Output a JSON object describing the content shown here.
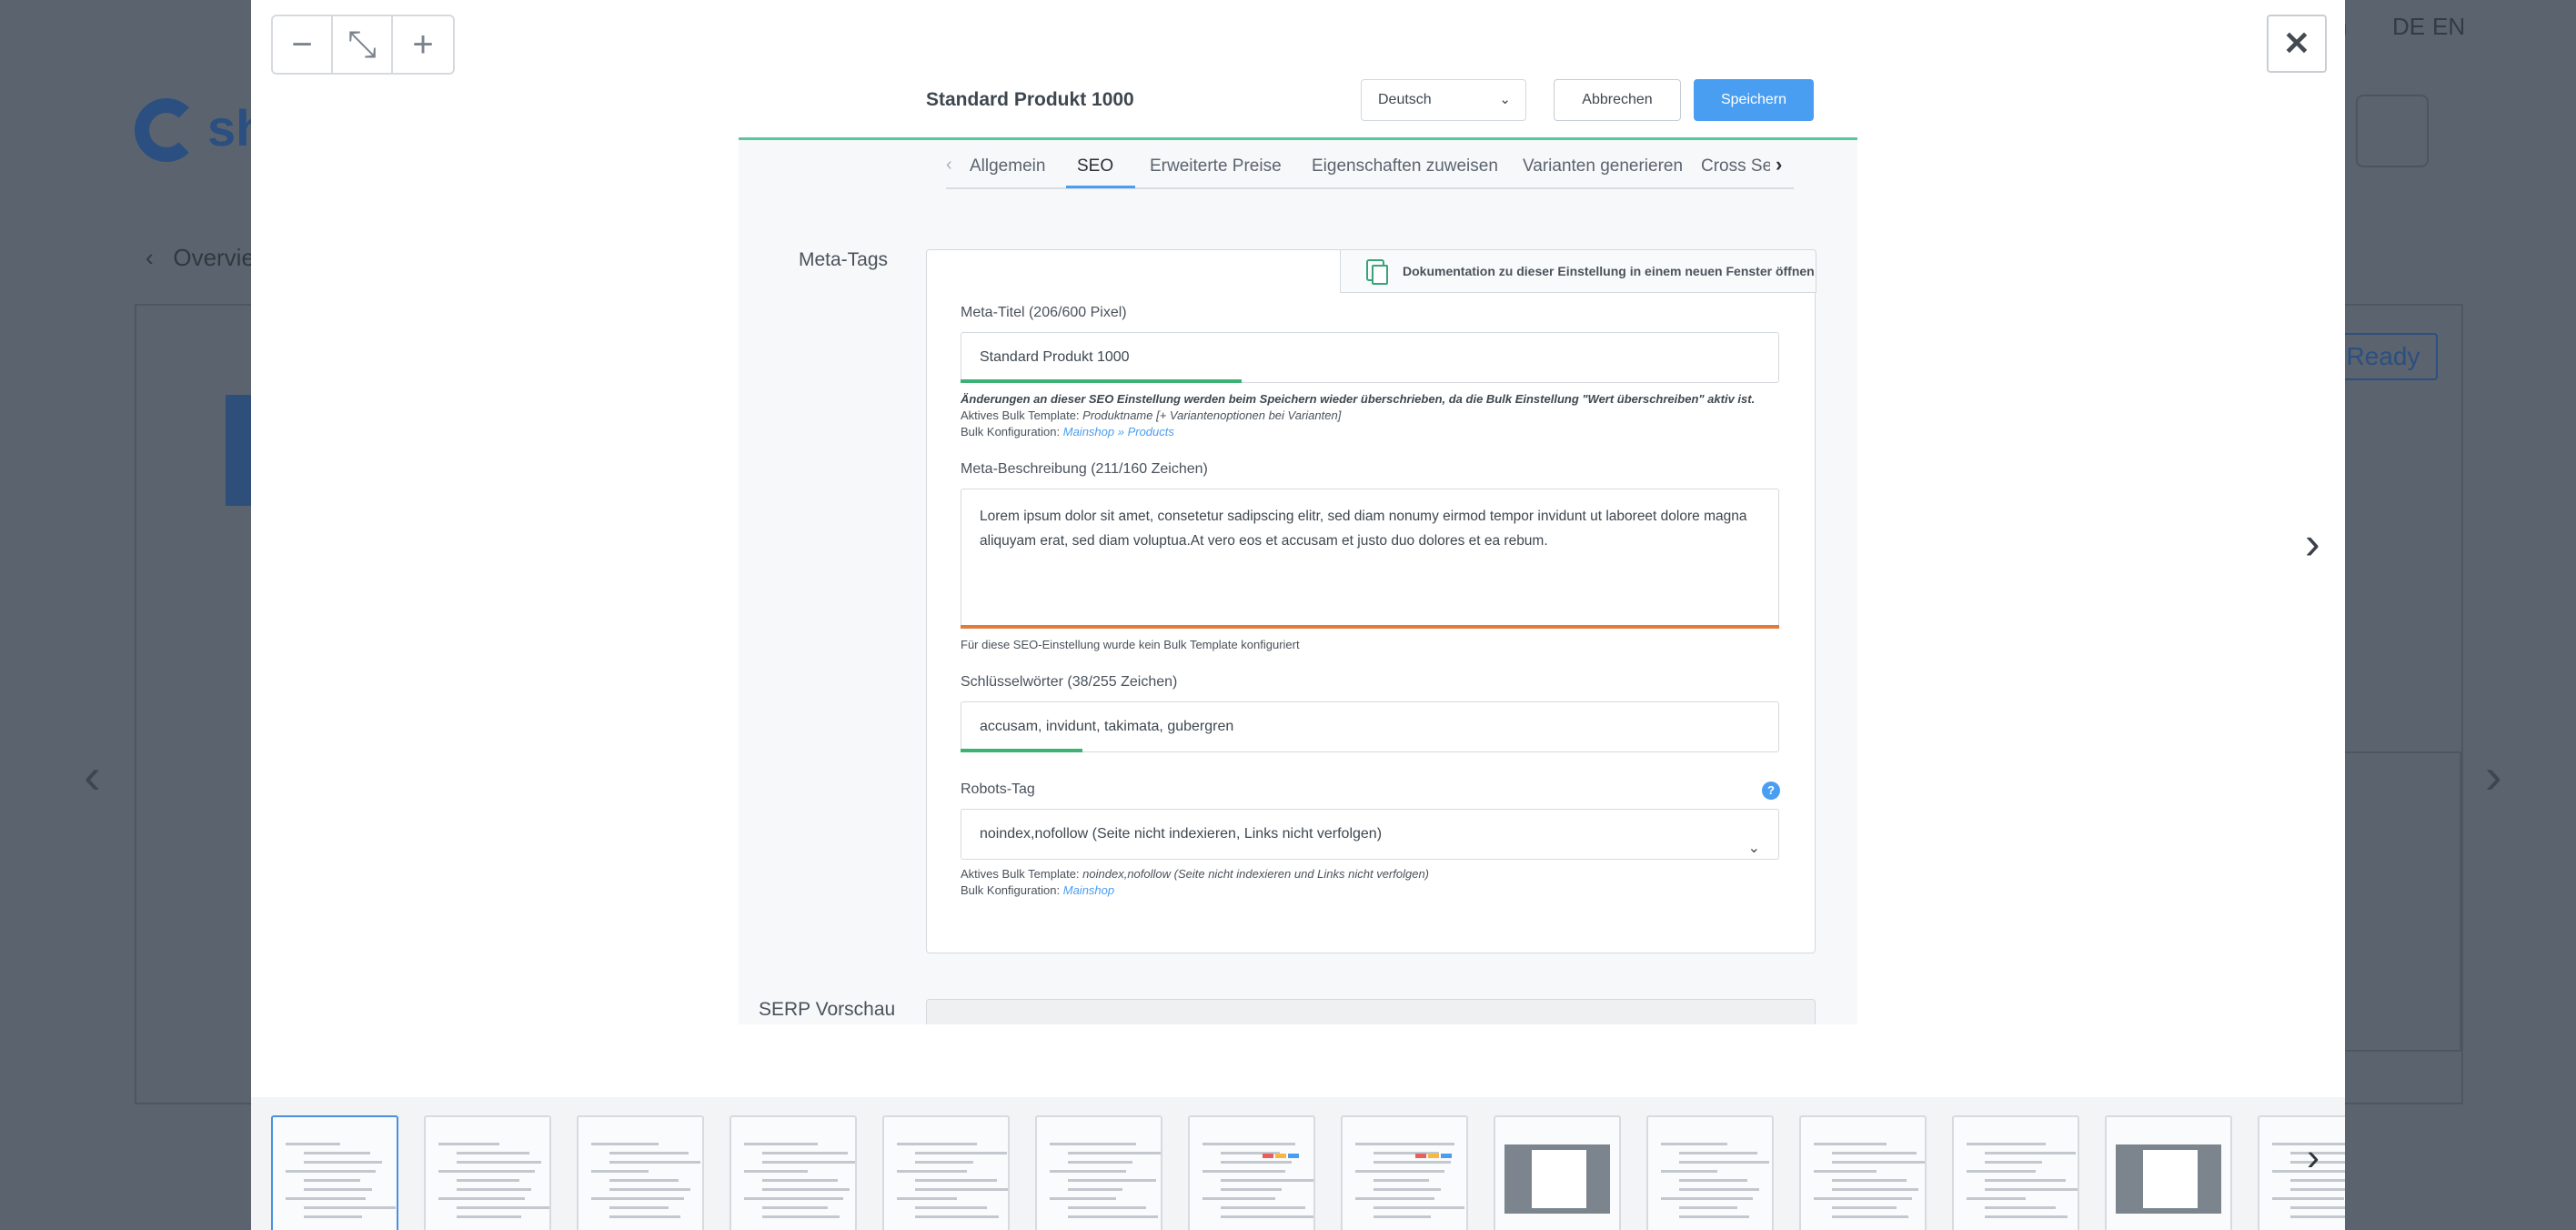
{
  "background": {
    "logo_text": "sh",
    "lang_de": "DE",
    "lang_en": "EN",
    "lang_prev": "n",
    "overview": "Overvie",
    "ready": "Ready"
  },
  "lightbox": {
    "zoom_out": "−",
    "reset_zoom": "⤡",
    "zoom_in": "+",
    "close": "✕",
    "next": "›",
    "thumbs_next": "›",
    "thumb_count": 14
  },
  "shot": {
    "product_title": "Standard Produkt 1000",
    "language": "Deutsch",
    "cancel": "Abbrechen",
    "save": "Speichern",
    "tabs": [
      "Allgemein",
      "SEO",
      "Erweiterte Preise",
      "Eigenschaften zuweisen",
      "Varianten generieren",
      "Cross Sel"
    ],
    "active_tab": "SEO",
    "section_meta": "Meta-Tags",
    "doc_link": "Dokumentation zu dieser Einstellung in einem neuen Fenster öffnen",
    "meta_title": {
      "label": "Meta-Titel (206/600 Pixel)",
      "value": "Standard Produkt 1000",
      "progress": 0.343,
      "warning": "Änderungen an dieser SEO Einstellung werden beim Speichern wieder überschrieben, da die Bulk Einstellung \"Wert überschreiben\" aktiv ist.",
      "template_label": "Aktives Bulk Template:",
      "template_value": "Produktname [+ Variantenoptionen bei Varianten]",
      "config_label": "Bulk Konfiguration:",
      "config_value": "Mainshop » Products"
    },
    "meta_description": {
      "label": "Meta-Beschreibung (211/160 Zeichen)",
      "value": "Lorem ipsum dolor sit amet, consetetur sadipscing elitr, sed diam nonumy eirmod tempor invidunt ut laboreet dolore magna aliquyam erat, sed diam voluptua.At vero eos et accusam et justo duo dolores et ea rebum.",
      "progress": 1.0,
      "note": "Für diese SEO-Einstellung wurde kein Bulk Template konfiguriert"
    },
    "keywords": {
      "label": "Schlüsselwörter (38/255 Zeichen)",
      "value": "accusam, invidunt, takimata, gubergren",
      "progress": 0.149
    },
    "robots": {
      "label": "Robots-Tag",
      "help": "?",
      "value": "noindex,nofollow (Seite nicht indexieren, Links nicht verfolgen)",
      "template_label": "Aktives Bulk Template:",
      "template_value": "noindex,nofollow (Seite nicht indexieren und Links nicht verfolgen)",
      "config_label": "Bulk Konfiguration:",
      "config_value": "Mainshop"
    },
    "section_serp": "SERP Vorschau"
  },
  "colors": {
    "accent": "#4a9ef2",
    "success": "#57c79d",
    "progress_good": "#3bb273",
    "progress_over": "#e07b39"
  }
}
